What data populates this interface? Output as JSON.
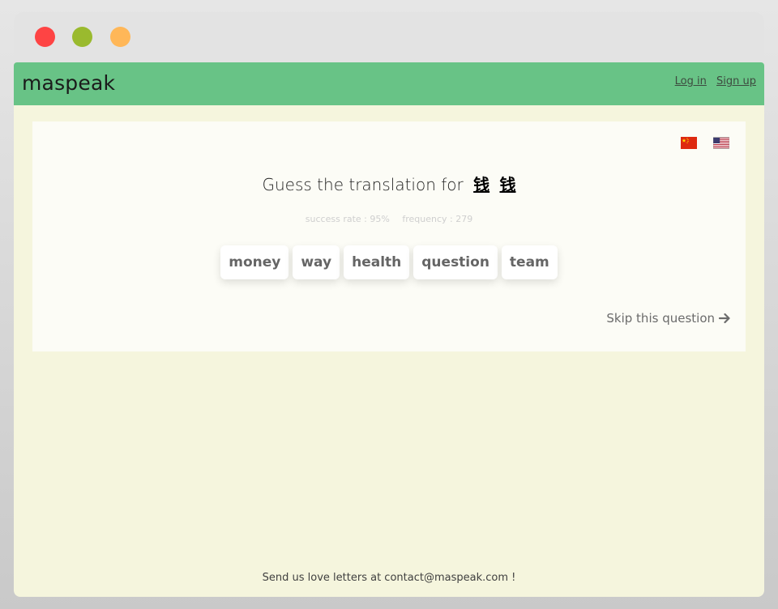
{
  "window": {
    "controls": [
      "close",
      "minimize",
      "maximize"
    ]
  },
  "navbar": {
    "brand": "maspeak",
    "login_label": "Log in",
    "signup_label": "Sign up"
  },
  "card": {
    "flags": [
      "china-flag-icon",
      "usa-flag-icon"
    ],
    "prompt_text": "Guess the translation for",
    "word_1": "钱",
    "word_2": "钱",
    "success_rate": "success rate : 95%",
    "frequency": "frequency : 279",
    "options": [
      "money",
      "way",
      "health",
      "question",
      "team"
    ],
    "skip_label": "Skip this question"
  },
  "footer": {
    "text": "Send us love letters at contact@maspeak.com !"
  },
  "colors": {
    "navbar": "#68c386",
    "page_bg": "#f5f5dd",
    "card_bg": "#fcfcf6"
  }
}
